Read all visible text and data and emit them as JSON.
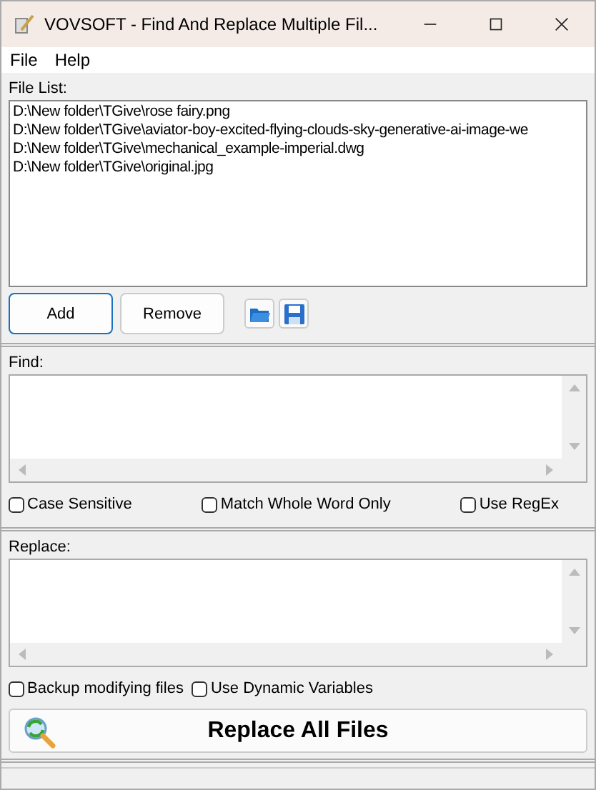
{
  "window": {
    "title": "VOVSOFT - Find And Replace Multiple Fil..."
  },
  "menu": [
    "File",
    "Help"
  ],
  "file_list": {
    "label": "File List:",
    "items": [
      "D:\\New folder\\TGive\\rose fairy.png",
      "D:\\New folder\\TGive\\aviator-boy-excited-flying-clouds-sky-generative-ai-image-we",
      "D:\\New folder\\TGive\\mechanical_example-imperial.dwg",
      "D:\\New folder\\TGive\\original.jpg"
    ]
  },
  "file_buttons": [
    "Add",
    "Remove"
  ],
  "find": {
    "label": "Find:",
    "options": [
      {
        "label": "Case Sensitive",
        "checked": false
      },
      {
        "label": "Match Whole Word Only",
        "checked": false
      },
      {
        "label": "Use RegEx",
        "checked": false
      }
    ]
  },
  "replace": {
    "label": "Replace:",
    "options": [
      {
        "label": "Backup modifying files",
        "checked": false
      },
      {
        "label": "Use Dynamic Variables",
        "checked": false
      }
    ]
  },
  "action_button": "Replace All Files"
}
